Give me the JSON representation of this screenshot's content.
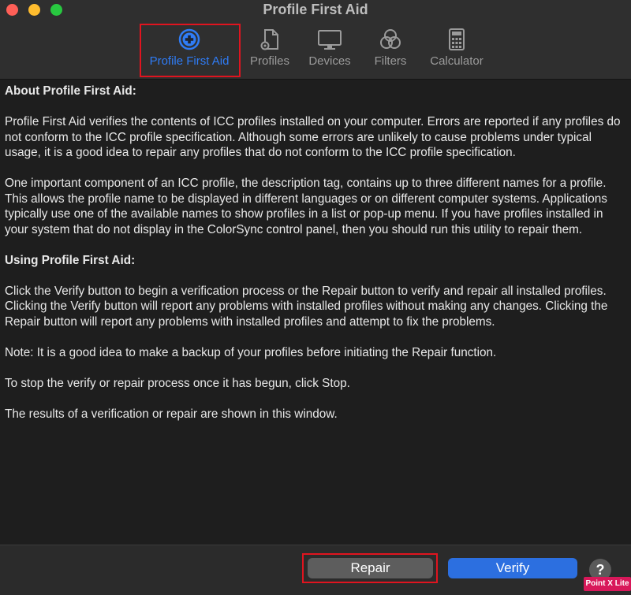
{
  "window": {
    "title": "Profile First Aid"
  },
  "toolbar": {
    "items": [
      {
        "label": "Profile First Aid",
        "icon": "first-aid-icon",
        "active": true
      },
      {
        "label": "Profiles",
        "icon": "profile-document-icon",
        "active": false
      },
      {
        "label": "Devices",
        "icon": "monitor-icon",
        "active": false
      },
      {
        "label": "Filters",
        "icon": "filters-circles-icon",
        "active": false
      },
      {
        "label": "Calculator",
        "icon": "calculator-icon",
        "active": false
      }
    ],
    "active_color": "#2f7cf6",
    "inactive_color": "#9b9b9b"
  },
  "content": {
    "heading_about": "About Profile First Aid:",
    "para1": "Profile First Aid verifies the contents of ICC profiles installed on your computer. Errors are reported if any profiles do not conform to the ICC profile specification. Although some errors are unlikely to cause problems under typical usage, it is a good idea to repair any profiles that do not conform to the ICC profile specification.",
    "para2": "One important component of an ICC profile, the description tag, contains up to three different names for a profile. This allows the profile name to be displayed in different languages or on different computer systems. Applications typically use one of the available names to show profiles in a list or pop-up menu. If you have profiles installed in your system that do not display in the ColorSync control panel, then you should run this utility to repair them.",
    "heading_using": "Using Profile First Aid:",
    "para3": "Click the Verify button to begin a verification process or the Repair button to verify and repair all installed profiles. Clicking the Verify button will report any problems with installed profiles without making any changes. Clicking the Repair button will report any problems with installed profiles and attempt to fix the problems.",
    "para4": "Note: It is a good idea to make a backup of your profiles before initiating the Repair function.",
    "para5": "To stop the verify or repair process once it has begun, click Stop.",
    "para6": "The results of a verification or repair are shown in this window."
  },
  "buttons": {
    "repair": "Repair",
    "verify": "Verify",
    "help": "?"
  },
  "colors": {
    "highlight": "#e0141f",
    "verify_button": "#2c6fe0",
    "repair_button": "#5d5d5d"
  },
  "watermark": "Point X Lite"
}
